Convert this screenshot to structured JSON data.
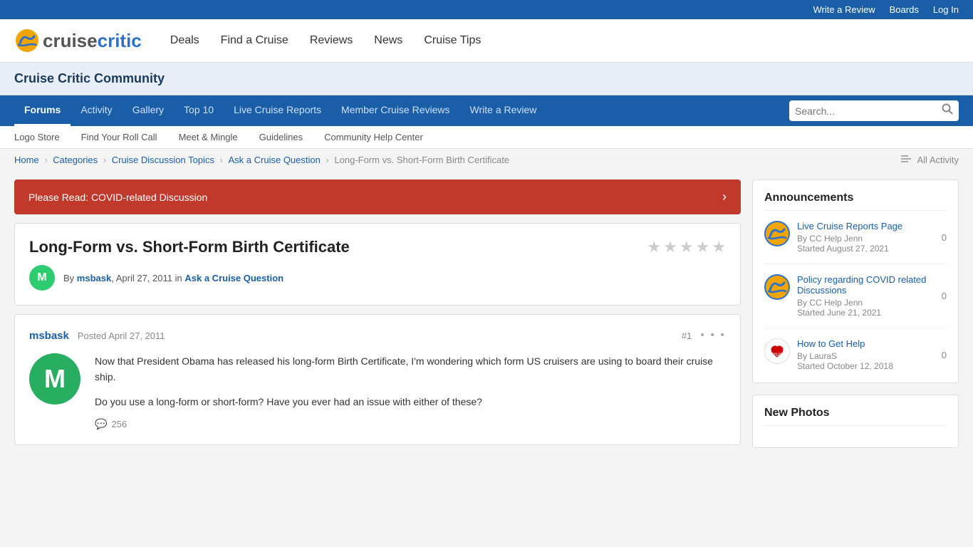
{
  "topbar": {
    "write_review": "Write a Review",
    "boards": "Boards",
    "log_in": "Log In"
  },
  "header": {
    "logo_text_cruise": "cruise",
    "logo_text_critic": "critic",
    "nav": [
      {
        "label": "Deals",
        "id": "deals"
      },
      {
        "label": "Find a Cruise",
        "id": "find-a-cruise"
      },
      {
        "label": "Reviews",
        "id": "reviews"
      },
      {
        "label": "News",
        "id": "news"
      },
      {
        "label": "Cruise Tips",
        "id": "cruise-tips"
      }
    ]
  },
  "community_bar": {
    "title": "Cruise Critic Community"
  },
  "forum_nav": {
    "links": [
      {
        "label": "Forums",
        "id": "forums",
        "active": true
      },
      {
        "label": "Activity",
        "id": "activity",
        "active": false
      },
      {
        "label": "Gallery",
        "id": "gallery",
        "active": false
      },
      {
        "label": "Top 10",
        "id": "top10",
        "active": false
      },
      {
        "label": "Live Cruise Reports",
        "id": "live-cruise-reports",
        "active": false
      },
      {
        "label": "Member Cruise Reviews",
        "id": "member-cruise-reviews",
        "active": false
      },
      {
        "label": "Write a Review",
        "id": "write-a-review",
        "active": false
      }
    ],
    "search_placeholder": "Search..."
  },
  "sub_nav": {
    "links": [
      {
        "label": "Logo Store"
      },
      {
        "label": "Find Your Roll Call"
      },
      {
        "label": "Meet & Mingle"
      },
      {
        "label": "Guidelines"
      },
      {
        "label": "Community Help Center"
      }
    ]
  },
  "breadcrumb": {
    "items": [
      {
        "label": "Home",
        "link": true
      },
      {
        "label": "Categories",
        "link": true
      },
      {
        "label": "Cruise Discussion Topics",
        "link": true
      },
      {
        "label": "Ask a Cruise Question",
        "link": true
      },
      {
        "label": "Long-Form vs. Short-Form Birth Certificate",
        "link": false
      }
    ],
    "all_activity": "All Activity"
  },
  "covid_banner": {
    "text": "Please Read: COVID-related Discussion"
  },
  "post_header": {
    "title": "Long-Form vs. Short-Form Birth Certificate",
    "stars": [
      "★",
      "★",
      "★",
      "★",
      "★"
    ],
    "author": "msbask",
    "date": "April 27, 2011",
    "in_text": "in",
    "category": "Ask a Cruise Question",
    "avatar_initial": "M"
  },
  "post_content": {
    "poster_name": "msbask",
    "posted_label": "Posted",
    "post_date": "April 27, 2011",
    "post_number": "#1",
    "avatar_initial": "M",
    "body_1": "Now that President Obama has released his long-form Birth Certificate, I'm wondering which form US cruisers are using to board their cruise ship.",
    "body_2": "Do you use a long-form or short-form? Have you ever had an issue with either of these?",
    "reply_count": "256"
  },
  "sidebar": {
    "announcements_title": "Announcements",
    "announcements": [
      {
        "id": "ann1",
        "title": "Live Cruise Reports Page",
        "by": "By CC Help Jenn",
        "started": "Started August 27, 2021",
        "count": "0"
      },
      {
        "id": "ann2",
        "title": "Policy regarding COVID related Discussions",
        "by": "By CC Help Jenn",
        "started": "Started June 21, 2021",
        "count": "0"
      },
      {
        "id": "ann3",
        "title": "How to Get Help",
        "by": "By LauraS",
        "started": "Started October 12, 2018",
        "count": "0",
        "heart": true
      }
    ],
    "new_photos_title": "New Photos"
  }
}
